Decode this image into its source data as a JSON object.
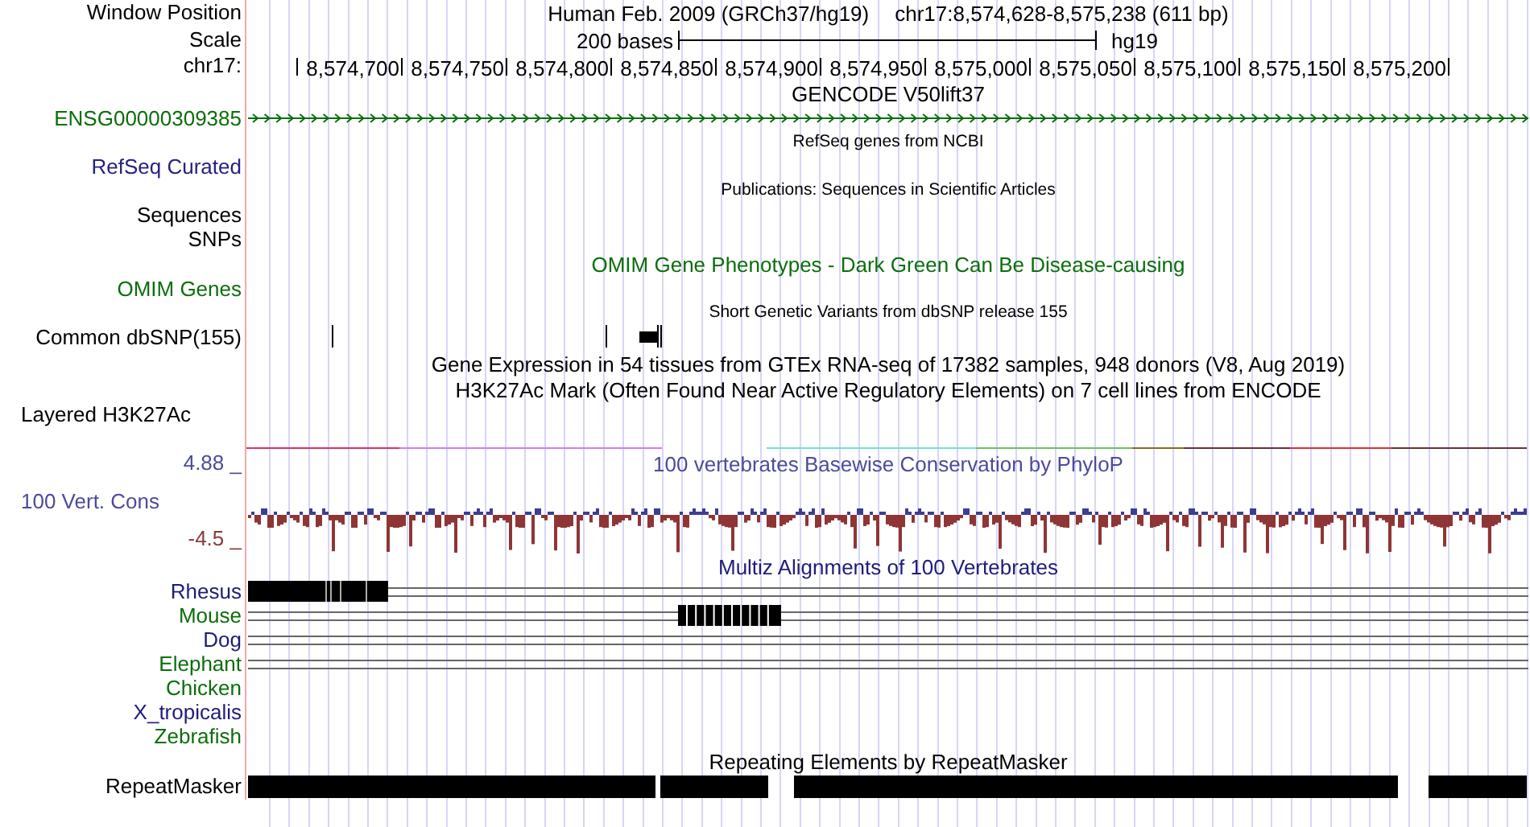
{
  "header": {
    "label": "Window Position",
    "assembly": "Human Feb. 2009 (GRCh37/hg19)",
    "position": "chr17:8,574,628-8,575,238 (611 bp)"
  },
  "scale": {
    "label": "Scale",
    "length": "200 bases",
    "assembly": "hg19"
  },
  "ruler": {
    "label": "chr17:",
    "ticks": [
      "8,574,700",
      "8,574,750",
      "8,574,800",
      "8,574,850",
      "8,574,900",
      "8,574,950",
      "8,575,000",
      "8,575,050",
      "8,575,100",
      "8,575,150",
      "8,575,200"
    ]
  },
  "tracks": [
    {
      "kind": "title",
      "text": "GENCODE V50lift37"
    },
    {
      "kind": "gene",
      "label": "ENSG00000309385",
      "color": "#0b6e0b"
    },
    {
      "kind": "caption",
      "text": "RefSeq genes from NCBI"
    },
    {
      "kind": "label",
      "label": "RefSeq Curated",
      "color": "#23237f"
    },
    {
      "kind": "caption",
      "text": "Publications: Sequences in Scientific Articles"
    },
    {
      "kind": "label",
      "label": "Sequences"
    },
    {
      "kind": "label",
      "label": "SNPs"
    },
    {
      "kind": "title",
      "text": "OMIM Gene Phenotypes - Dark Green Can Be Disease-causing",
      "color": "#0b6e0b"
    },
    {
      "kind": "label",
      "label": "OMIM Genes",
      "color": "#0b6e0b"
    },
    {
      "kind": "caption",
      "text": "Short Genetic Variants from dbSNP release 155"
    },
    {
      "kind": "snp",
      "label": "Common dbSNP(155)"
    },
    {
      "kind": "title",
      "text": "Gene Expression in 54 tissues from GTEx RNA-seq of 17382 samples, 948 donors (V8, Aug 2019)"
    },
    {
      "kind": "title",
      "text": "H3K27Ac Mark (Often Found Near Active Regulatory Elements) on 7 cell lines from ENCODE"
    },
    {
      "kind": "left-label",
      "label": "Layered H3K27Ac"
    },
    {
      "kind": "signal"
    },
    {
      "kind": "scale-top",
      "label": "4.88 _",
      "text": "100 vertebrates Basewise Conservation by PhyloP",
      "color": "#4b4b9b"
    },
    {
      "kind": "wiggle",
      "label": "100 Vert. Cons",
      "bottom": "-4.5 _",
      "color": "#4b4b9b"
    },
    {
      "kind": "title",
      "text": "Multiz Alignments of 100 Vertebrates",
      "color": "#1c1c78"
    },
    {
      "kind": "blocks",
      "label": "Rhesus",
      "color": "#1c1c78"
    },
    {
      "kind": "blocks",
      "label": "Mouse",
      "color": "#0b6e0b"
    },
    {
      "kind": "lines",
      "label": "Dog",
      "color": "#1c1c78"
    },
    {
      "kind": "lines",
      "label": "Elephant",
      "color": "#0b6e0b"
    },
    {
      "kind": "empty",
      "label": "Chicken",
      "color": "#0b6e0b"
    },
    {
      "kind": "empty",
      "label": "X_tropicalis",
      "color": "#1c1c78"
    },
    {
      "kind": "empty",
      "label": "Zebrafish",
      "color": "#0b6e0b"
    },
    {
      "kind": "title",
      "text": "Repeating Elements by RepeatMasker"
    },
    {
      "kind": "repeat",
      "label": "RepeatMasker"
    }
  ]
}
